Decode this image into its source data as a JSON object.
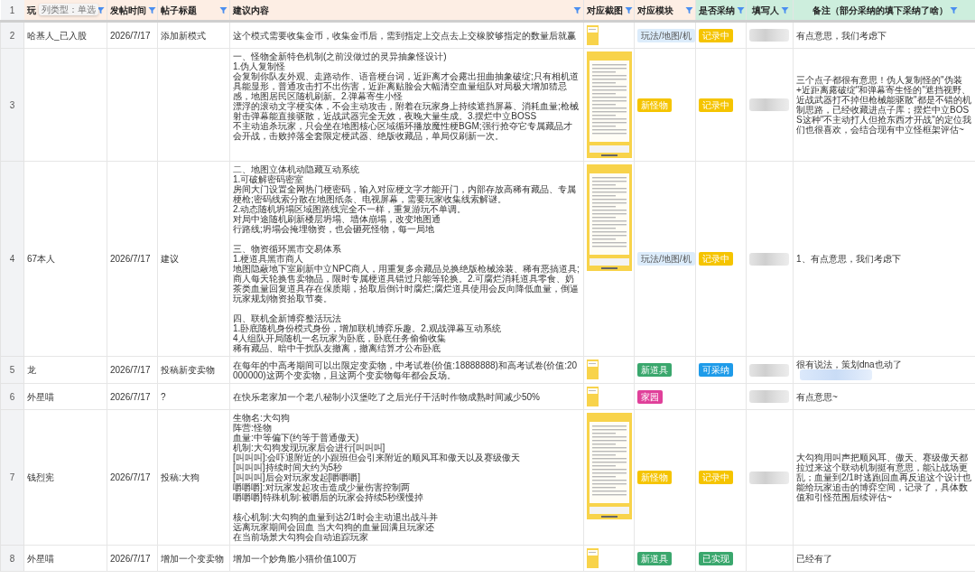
{
  "header": {
    "number": "1",
    "tooltip": "列类型：单选",
    "columns": [
      {
        "label": "玩",
        "color": "#fdeee4"
      },
      {
        "label": "发帖时间",
        "color": "#fdeee4"
      },
      {
        "label": "帖子标题",
        "color": "#fdeee4"
      },
      {
        "label": "建议内容",
        "color": "#fdeee4"
      },
      {
        "label": "对应截图",
        "color": "#fdeee4"
      },
      {
        "label": "对应模块",
        "color": "#fdeee4"
      },
      {
        "label": "是否采纳",
        "color": "#cdeedd"
      },
      {
        "label": "填写人",
        "color": "#cdeedd"
      },
      {
        "label": "备注（部分采纳的填下采纳了啥）",
        "color": "#cdeedd"
      }
    ]
  },
  "rows": [
    {
      "number": "2",
      "player": "哈基人_已入股",
      "date": "2026/7/17",
      "title": "添加新模式",
      "content": [
        [
          "这个模式需要收集金币，收集金币后，需到指定上交点去上交橡胶够指定的数量后就赢"
        ]
      ],
      "screenshot": {
        "kind": "small"
      },
      "module": {
        "label": "玩法/地图/机",
        "color": "#dcecfb"
      },
      "adoption": {
        "label": "记录中",
        "color": "#f5c400"
      },
      "filler_blurred": true,
      "note": "有点意思，我们考虑下",
      "note_blurred": false
    },
    {
      "number": "3",
      "content": [
        [
          "一、怪物全新特色机制(之前没做过的灵异抽象怪设计)",
          "1.伪人复制怪",
          "会复制你队友外观、走路动作、语音梗台词，近距离才会露出扭曲抽象破绽;只有相机道具能显形，普通攻击打不出伤害，近距离贴脸会大幅清空血量组队对局极大增加猜忌感，地图居民区随机刷新。2.弹幕寄生小怪",
          "漂浮的滚动文字梗实体，不会主动攻击，附着在玩家身上持续遮挡屏幕、消耗血量;枪械射击弹幕能直接驱散，近战武器完全无效，夜晚大量生成。3.摆烂中立BOSS",
          "不主动追杀玩家，只会坐在地图核心区域循环播放魔性梗BGM;强行抢夺它专属藏品才会开战，击败掉落全套限定梗武器、绝版收藏品，单局仅刷新一次。"
        ]
      ],
      "screenshot": {
        "kind": "large"
      },
      "module": {
        "label": "新怪物",
        "color": "#f5c400"
      },
      "adoption": {
        "label": "记录中",
        "color": "#f5c400"
      },
      "filler_blurred": true,
      "note": "三个点子都很有意思！伪人复制怪的\"伪装+近距离露破绽\"和弹幕寄生怪的\"遮挡视野、近战武器打不掉但枪械能驱散\"都是不错的机制思路，已经收藏进点子库；摆烂中立BOSS这种\"不主动打人但抢东西才开战\"的定位我们也很喜欢，会结合现有中立怪框架评估~",
      "note_blurred": false
    },
    {
      "number": "4",
      "player": "67本人",
      "date": "2026/7/17",
      "title": "建议",
      "content": [
        [
          "二、地图立体机动隐藏互动系统",
          "1.可破解密码密室",
          "房间大门设置全网热门梗密码，输入对应梗文字才能开门，内部存放高稀有藏品、专属梗枪;密码线索分散在地图纸条、电视屏幕，需要玩家收集线索解谜。",
          "2.动态随机坍塌区域图路线完全不一样，重复游玩不单调。",
          "对局中途随机刷新楼层坍塌、墙体崩塌，改变地图通",
          "行路线;坍塌会掩埋物资，也会砸死怪物，每一局地"
        ],
        [
          "三、物资循环黑市交易体系",
          "1.梗道具黑市商人",
          "地图隐蔽地下室刷新中立NPC商人，用重复多余藏品兑换绝版枪械涂装、稀有恶搞道具;商人每天轮换售卖物品，限时专属梗道具错过只能等轮换。2.可腐烂消耗道具零食、奶茶类血量回复道具存在保质期，拾取后倒计时腐烂;腐烂道具使用会反向降低血量，倒逼玩家规划物资拾取节奏。"
        ],
        [
          "四、联机全新博弈整活玩法",
          "1.卧底随机身份模式身份，增加联机博弈乐趣。2.观战弹幕互动系统",
          "4人组队开局随机一名玩家为卧底，卧底任务偷偷收集",
          "稀有藏品、暗中干扰队友撤离，撤离结算才公布卧底"
        ]
      ],
      "screenshot": {
        "kind": "large"
      },
      "module": {
        "label": "玩法/地图/机",
        "color": "#dcecfb"
      },
      "adoption": {
        "label": "记录中",
        "color": "#f5c400"
      },
      "filler_blurred": true,
      "note": "1、有点意思，我们考虑下",
      "note_blurred": false
    },
    {
      "number": "5",
      "player": "龙",
      "date": "2026/7/17",
      "title": "投稿新变卖物",
      "content": [
        [
          "在每年的中高考期间可以出限定变卖物，中考试卷(价值:18888888)和高考试卷(价值:20000000)这两个变卖物，且这两个变卖物每年都会反场。"
        ]
      ],
      "screenshot": {
        "kind": "small"
      },
      "module": {
        "label": "新道具",
        "color": "#3aa76d"
      },
      "adoption": {
        "label": "可采纳",
        "color": "#1e9be9"
      },
      "filler_blurred": true,
      "note": "很有说法，策划dna也动了",
      "note_blurred": true
    },
    {
      "number": "6",
      "player": "外星喵",
      "date": "2026/7/17",
      "title": "?",
      "content": [
        [
          "在快乐老家加一个老八秘制小汉堡吃了之后光仔干活时作物成熟时间减少50%"
        ]
      ],
      "screenshot": {
        "kind": "small"
      },
      "module": {
        "label": "家园",
        "color": "#e0409a"
      },
      "filler_blurred": true,
      "note": "有点意思~",
      "note_blurred": false
    },
    {
      "number": "7",
      "player": "钱烈宪",
      "date": "2026/7/17",
      "title": "投稿:大狗",
      "content": [
        [
          "生物名:大勾狗",
          "阵营:怪物",
          "血量:中等偏下(约等于普通傲天)",
          "机制:大勾狗发现玩家后会进行[叫叫叫]",
          "[叫叫叫]:会吓退附近的小跟班但会引来附近的顺风耳和傲天以及赛级傲天",
          "[叫叫叫]持续时间大约为5秒",
          "[叫叫叫]后会对玩家发起[嚼嚼嚼]",
          "嚼嚼嚼]:对玩家发起攻击造成少量伤害控制两",
          "嚼嚼嚼]特殊机制:被嚼后的玩家会持续5秒缓慢掉"
        ],
        [
          "核心机制:大勾狗的血量到达2/1时会主动退出战斗并",
          "远离玩家期间会回血 当大勾狗的血量回满且玩家还",
          "在当前场景大勾狗会自动追踪玩家"
        ]
      ],
      "screenshot": {
        "kind": "large"
      },
      "module": {
        "label": "新怪物",
        "color": "#f5c400"
      },
      "adoption": {
        "label": "记录中",
        "color": "#f5c400"
      },
      "filler_blurred": true,
      "note": "大勾狗用叫声把顺风耳、傲天、赛级傲天都拉过来这个联动机制挺有意思，能让战场更乱；血量到2/1时逃跑回血再反追这个设计也能给玩家追击的博弈空间，记录了，具体数值和引怪范围后续评估~",
      "note_blurred": false
    },
    {
      "number": "8",
      "player": "外星喵",
      "date": "2026/7/17",
      "title": "增加一个变卖物",
      "content": [
        [
          "增加一个妙角脆小猫价值100万"
        ]
      ],
      "screenshot": {
        "kind": "small"
      },
      "module": {
        "label": "新道具",
        "color": "#3aa76d"
      },
      "adoption": {
        "label": "已实现",
        "color": "#3aa76d"
      },
      "filler_blurred": false,
      "note": "已经有了",
      "note_blurred": false
    }
  ]
}
